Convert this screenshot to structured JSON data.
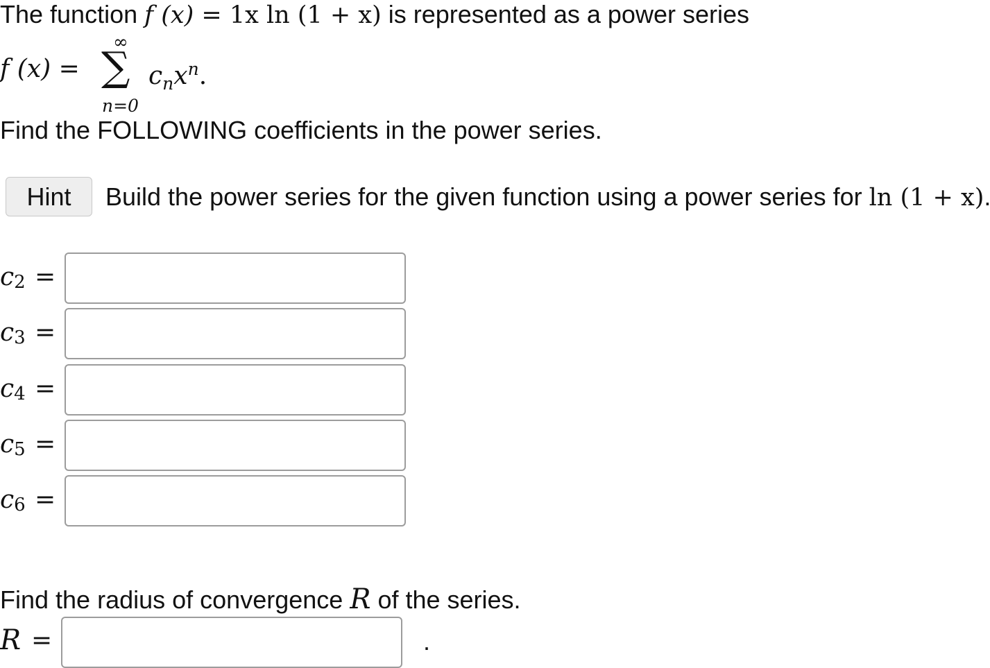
{
  "intro": {
    "prefix": "The function ",
    "func_lhs": "f (x) = ",
    "func_rhs": "1x ln (1 + x)",
    "suffix": " is represented as a power series"
  },
  "series": {
    "lhs": "f (x) = ",
    "sigma": "∑",
    "upper": "∞",
    "lower": "n=0",
    "coef": "c",
    "coef_sub": "n",
    "var": "x",
    "var_sup": "n",
    "end": "."
  },
  "find_following": "Find the FOLLOWING coefficients in the power series.",
  "hint": {
    "button_label": "Hint",
    "text_prefix": "Build the power series for the given function using a power series for ",
    "math": "ln (1 + x)",
    "text_suffix": "."
  },
  "coefficients": [
    {
      "symbol": "c",
      "index": "2",
      "equals": "=",
      "value": ""
    },
    {
      "symbol": "c",
      "index": "3",
      "equals": "=",
      "value": ""
    },
    {
      "symbol": "c",
      "index": "4",
      "equals": "=",
      "value": ""
    },
    {
      "symbol": "c",
      "index": "5",
      "equals": "=",
      "value": ""
    },
    {
      "symbol": "c",
      "index": "6",
      "equals": "=",
      "value": ""
    }
  ],
  "radius": {
    "prompt_prefix": "Find the radius of convergence ",
    "symbol": "R",
    "prompt_suffix": " of the series.",
    "label": "R",
    "equals": "=",
    "value": "",
    "period": "."
  }
}
